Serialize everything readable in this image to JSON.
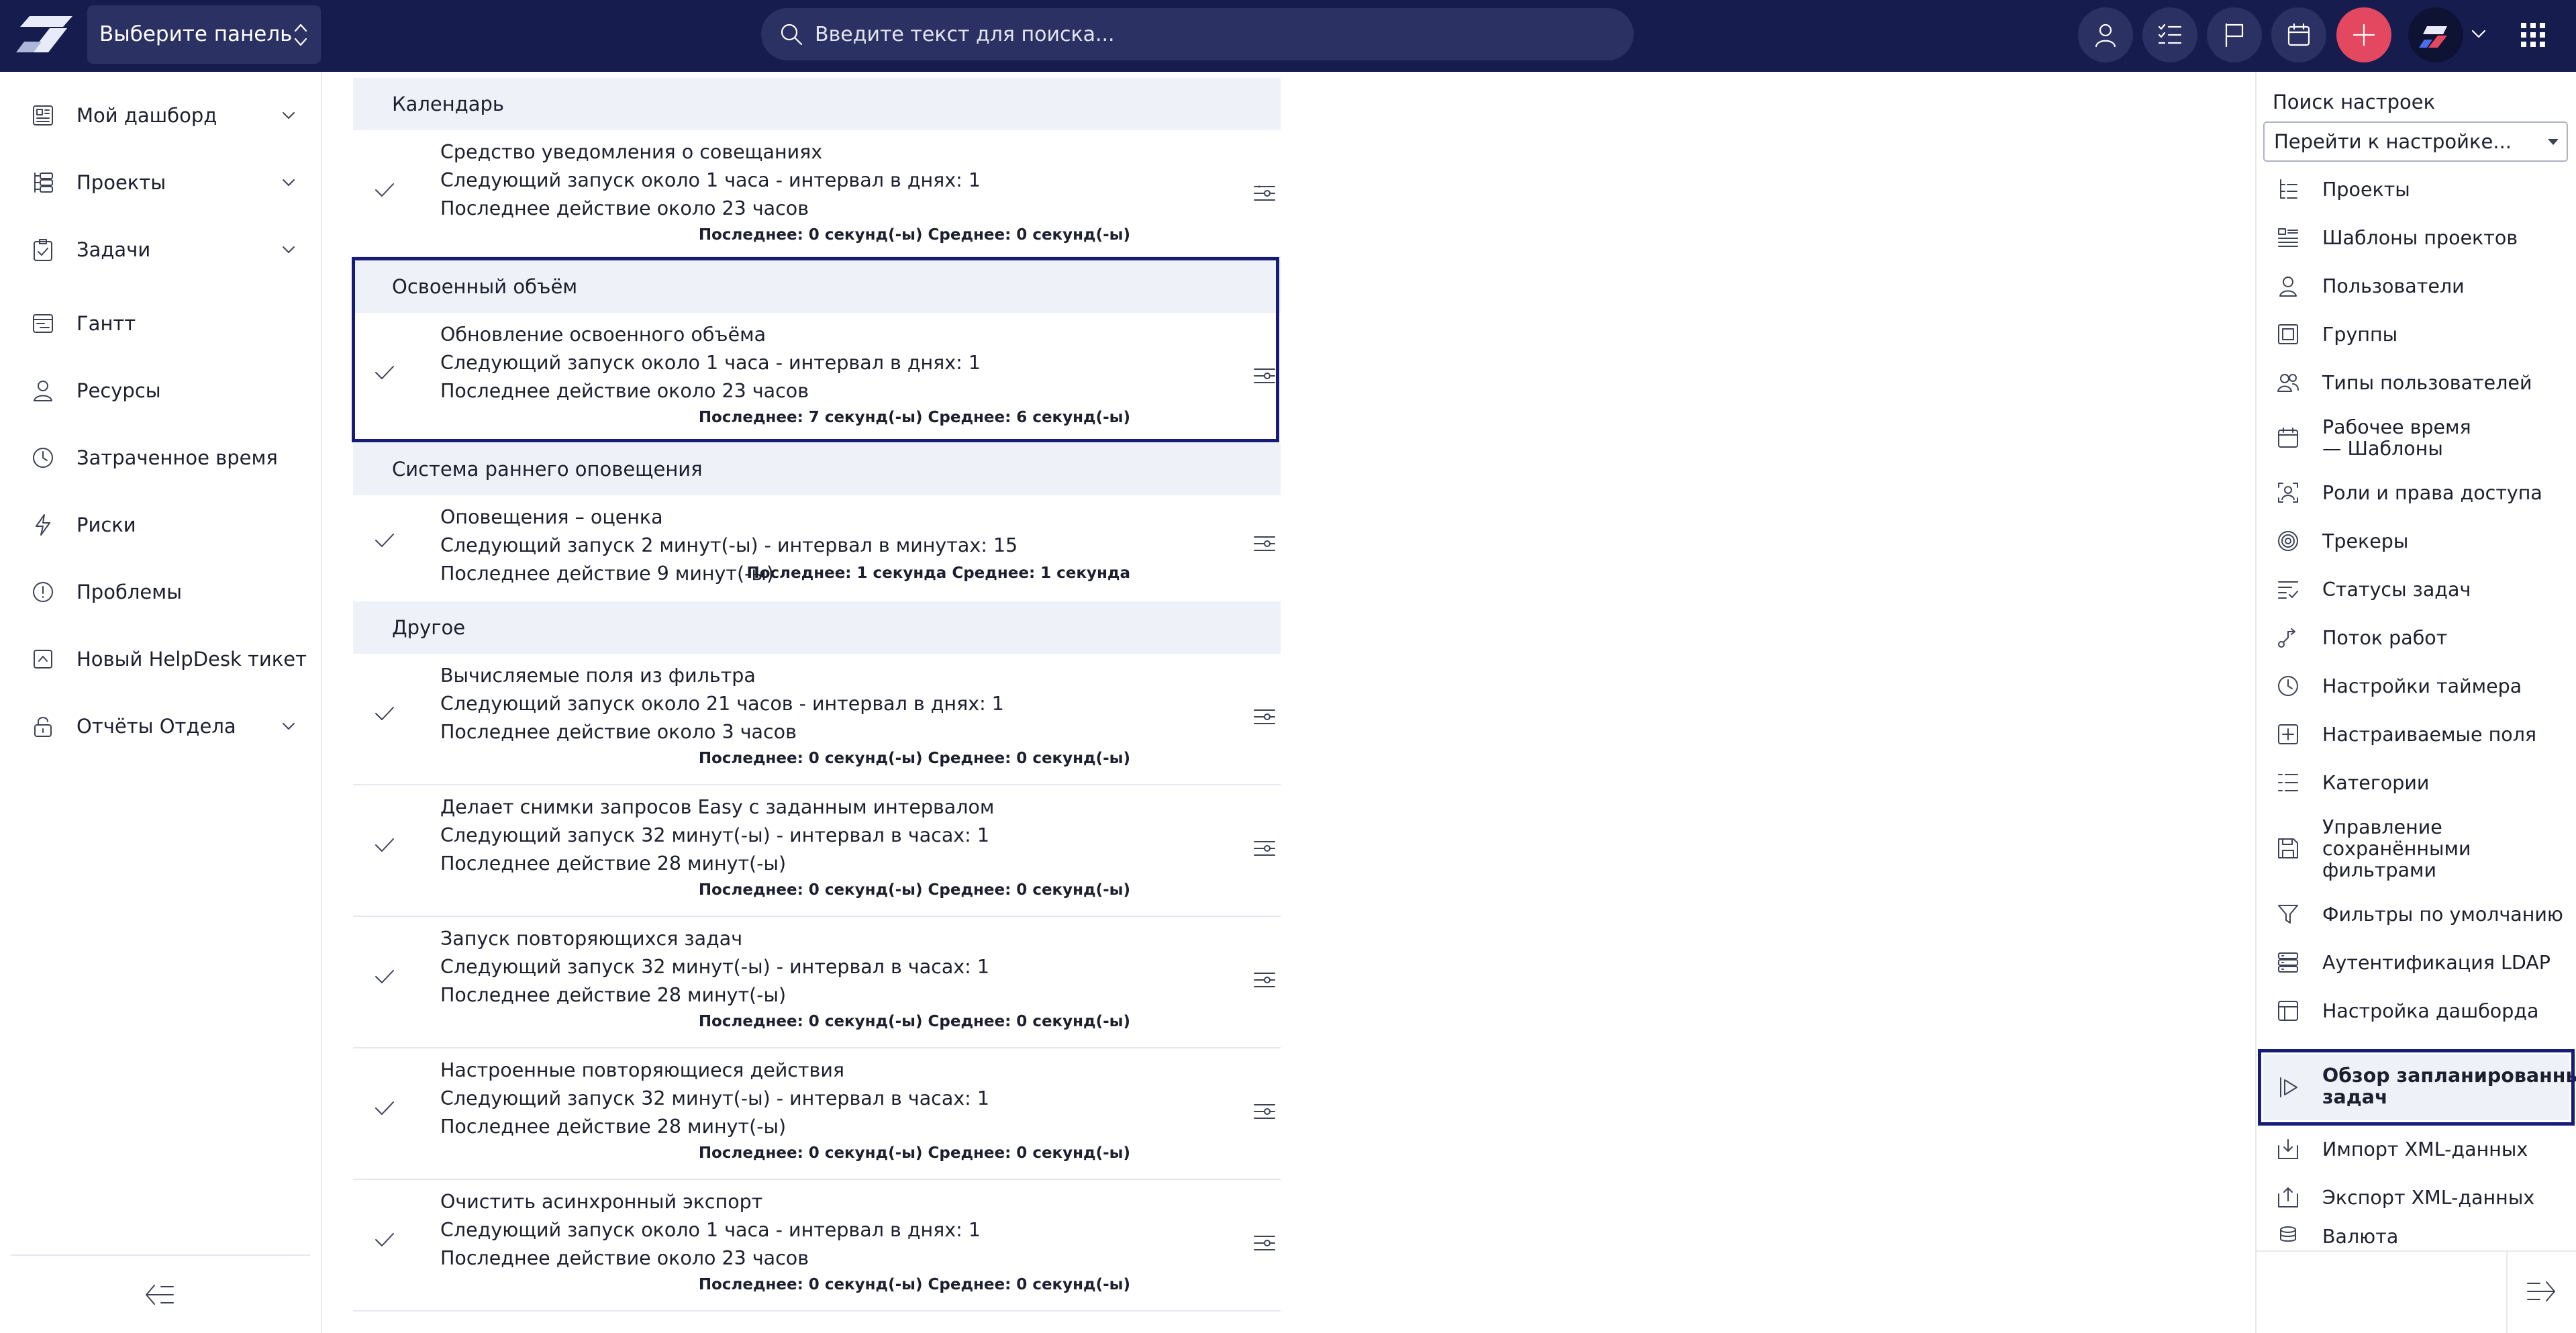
{
  "topbar": {
    "panel_select": "Выберите панель",
    "search_placeholder": "Введите текст для поиска..."
  },
  "sidebar": {
    "items": [
      {
        "label": "Мой дашборд",
        "icon": "dashboard-icon",
        "has_children": true
      },
      {
        "label": "Проекты",
        "icon": "projects-icon",
        "has_children": true
      },
      {
        "label": "Задачи",
        "icon": "tasks-icon",
        "has_children": true
      },
      {
        "label": "Гантт",
        "icon": "gantt-icon",
        "has_children": false
      },
      {
        "label": "Ресурсы",
        "icon": "user-icon",
        "has_children": false
      },
      {
        "label": "Затраченное время",
        "icon": "clock-icon",
        "has_children": false
      },
      {
        "label": "Риски",
        "icon": "lightning-icon",
        "has_children": false
      },
      {
        "label": "Проблемы",
        "icon": "alert-icon",
        "has_children": false
      },
      {
        "label": "Новый HelpDesk тикет",
        "icon": "helpdesk-icon",
        "has_children": false
      },
      {
        "label": "Отчёты Отдела",
        "icon": "lock-icon",
        "has_children": true
      }
    ]
  },
  "sections": [
    {
      "title": "Календарь"
    },
    {
      "title": "Освоенный объём"
    },
    {
      "title": "Система раннего оповещения"
    },
    {
      "title": "Другое"
    }
  ],
  "jobs": [
    {
      "name": "Средство уведомления о совещаниях",
      "next": "Следующий запуск около 1 часа - интервал в днях: 1",
      "last": "Последнее действие около 23 часов",
      "stats": "Последнее: 0 секунд(-ы) Среднее: 0 секунд(-ы)"
    },
    {
      "name": "Обновление освоенного объёма",
      "next": "Следующий запуск около 1 часа - интервал в днях: 1",
      "last": "Последнее действие около 23 часов",
      "stats": "Последнее: 7 секунд(-ы) Среднее: 6 секунд(-ы)"
    },
    {
      "name": "Оповещения – оценка",
      "next": "Следующий запуск 2 минут(-ы) - интервал в минутах: 15",
      "last": "Последнее действие 9 минут(-ы)",
      "stats": "Последнее: 1 секунда Среднее: 1 секунда"
    },
    {
      "name": "Вычисляемые поля из фильтра",
      "next": "Следующий запуск около 21 часов - интервал в днях: 1",
      "last": "Последнее действие около 3 часов",
      "stats": "Последнее: 0 секунд(-ы) Среднее: 0 секунд(-ы)"
    },
    {
      "name": "Делает снимки запросов Easy с заданным интервалом",
      "next": "Следующий запуск 32 минут(-ы) - интервал в часах: 1",
      "last": "Последнее действие 28 минут(-ы)",
      "stats": "Последнее: 0 секунд(-ы) Среднее: 0 секунд(-ы)"
    },
    {
      "name": "Запуск повторяющихся задач",
      "next": "Следующий запуск 32 минут(-ы) - интервал в часах: 1",
      "last": "Последнее действие 28 минут(-ы)",
      "stats": "Последнее: 0 секунд(-ы) Среднее: 0 секунд(-ы)"
    },
    {
      "name": "Настроенные повторяющиеся действия",
      "next": "Следующий запуск 32 минут(-ы) - интервал в часах: 1",
      "last": "Последнее действие 28 минут(-ы)",
      "stats": "Последнее: 0 секунд(-ы) Среднее: 0 секунд(-ы)"
    },
    {
      "name": "Очистить асинхронный экспорт",
      "next": "Следующий запуск около 1 часа - интервал в днях: 1",
      "last": "Последнее действие около 23 часов",
      "stats": "Последнее: 0 секунд(-ы) Среднее: 0 секунд(-ы)"
    }
  ],
  "settings_panel": {
    "title": "Поиск настроек",
    "select": "Перейти к настройке...",
    "items": [
      {
        "label": "Проекты",
        "icon": "projects-tree-icon"
      },
      {
        "label": "Шаблоны проектов",
        "icon": "templates-icon"
      },
      {
        "label": "Пользователи",
        "icon": "user-icon"
      },
      {
        "label": "Группы",
        "icon": "groups-icon"
      },
      {
        "label": "Типы пользователей",
        "icon": "user-types-icon"
      },
      {
        "label": "Рабочее время",
        "label2": "— Шаблоны",
        "icon": "calendar-icon"
      },
      {
        "label": "Роли и права доступа",
        "icon": "roles-icon"
      },
      {
        "label": "Трекеры",
        "icon": "target-icon"
      },
      {
        "label": "Статусы задач",
        "icon": "status-list-icon"
      },
      {
        "label": "Поток работ",
        "icon": "workflow-icon"
      },
      {
        "label": "Настройки таймера",
        "icon": "clock-icon"
      },
      {
        "label": "Настраиваемые поля",
        "icon": "plus-box-icon"
      },
      {
        "label": "Категории",
        "icon": "categories-icon"
      },
      {
        "label": "Управление",
        "label2": "сохранёнными",
        "label3": "фильтрами",
        "icon": "save-icon"
      },
      {
        "label": "Фильтры по умолчанию",
        "icon": "filter-icon"
      },
      {
        "label": "Аутентификация LDAP",
        "icon": "server-icon"
      },
      {
        "label": "Настройка дашборда",
        "icon": "dashboard-layout-icon"
      },
      {
        "label": "Обзор запланированных",
        "label2": "задач",
        "icon": "play-icon",
        "active": true
      },
      {
        "label": "Импорт XML-данных",
        "icon": "import-icon"
      },
      {
        "label": "Экспорт XML-данных",
        "icon": "export-icon"
      },
      {
        "label": "Валюта",
        "icon": "coins-icon"
      }
    ]
  }
}
